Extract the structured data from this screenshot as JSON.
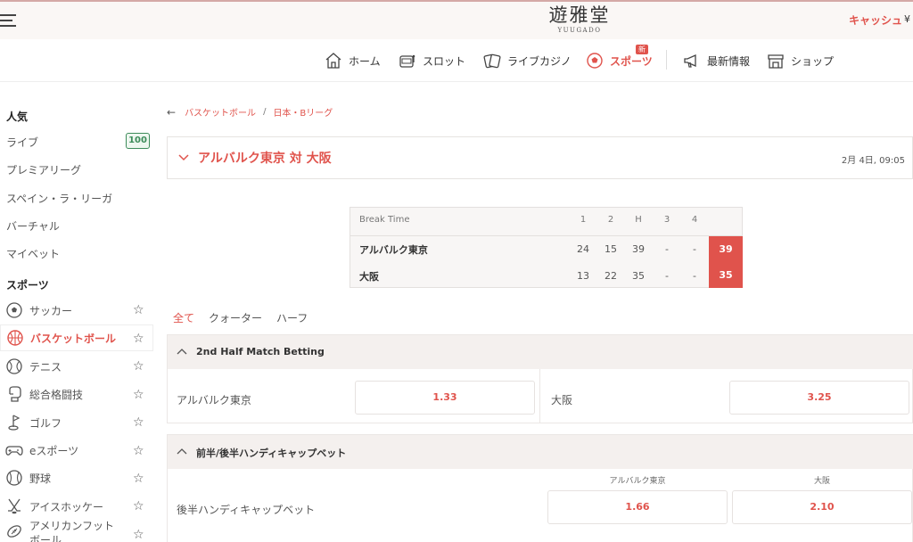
{
  "brand": {
    "logo_main": "遊雅堂",
    "logo_sub": "YUUGADO",
    "cash_label": "キャッシュ",
    "currency": "¥"
  },
  "nav": {
    "items": [
      {
        "label": "ホーム",
        "icon": "home-icon"
      },
      {
        "label": "スロット",
        "icon": "slot-icon"
      },
      {
        "label": "ライブカジノ",
        "icon": "cards-icon"
      },
      {
        "label": "スポーツ",
        "icon": "soccer-ball-icon",
        "active": true,
        "badge": "新"
      },
      {
        "label": "最新情報",
        "icon": "megaphone-icon"
      },
      {
        "label": "ショップ",
        "icon": "shop-icon"
      }
    ]
  },
  "sidebar": {
    "popular_heading": "人気",
    "popular": [
      {
        "label": "ライブ",
        "badge": "100"
      },
      {
        "label": "プレミアリーグ"
      },
      {
        "label": "スペイン・ラ・リーガ"
      },
      {
        "label": "バーチャル"
      },
      {
        "label": "マイベット"
      }
    ],
    "sports_heading": "スポーツ",
    "sports": [
      {
        "label": "サッカー",
        "icon": "soccer-icon"
      },
      {
        "label": "バスケットボール",
        "icon": "basketball-icon",
        "active": true
      },
      {
        "label": "テニス",
        "icon": "tennis-icon"
      },
      {
        "label": "総合格闘技",
        "icon": "boxing-glove-icon"
      },
      {
        "label": "ゴルフ",
        "icon": "golf-icon"
      },
      {
        "label": "eスポーツ",
        "icon": "gamepad-icon"
      },
      {
        "label": "野球",
        "icon": "baseball-icon"
      },
      {
        "label": "アイスホッケー",
        "icon": "hockey-icon"
      },
      {
        "label": "アメリカンフットボール",
        "icon": "football-icon"
      }
    ],
    "star": "☆"
  },
  "breadcrumb": {
    "back": "←",
    "items": [
      "バスケットボール",
      "日本・Bリーグ"
    ],
    "sep": "/"
  },
  "match": {
    "title": "アルバルク東京 対 大阪",
    "date": "2月 4日, 09:05"
  },
  "scoreboard": {
    "status": "Break Time",
    "columns": [
      "1",
      "2",
      "H",
      "3",
      "4"
    ],
    "teams": [
      {
        "name": "アルバルク東京",
        "scores": [
          "24",
          "15",
          "39",
          "-",
          "-"
        ],
        "total": "39"
      },
      {
        "name": "大阪",
        "scores": [
          "13",
          "22",
          "35",
          "-",
          "-"
        ],
        "total": "35"
      }
    ]
  },
  "tabs": [
    "全て",
    "クォーター",
    "ハーフ"
  ],
  "markets": [
    {
      "title": "2nd Half Match Betting",
      "options": [
        {
          "label": "アルバルク東京",
          "odds": "1.33"
        },
        {
          "label": "大阪",
          "odds": "3.25"
        }
      ]
    },
    {
      "title": "前半/後半ハンディキャップベット",
      "row_label": "後半ハンディキャップベット",
      "columns": [
        "アルバルク東京",
        "大阪"
      ],
      "odds": [
        "1.66",
        "2.10"
      ]
    }
  ],
  "colors": {
    "accent": "#e0534c",
    "live_green": "#3d8c5a"
  }
}
